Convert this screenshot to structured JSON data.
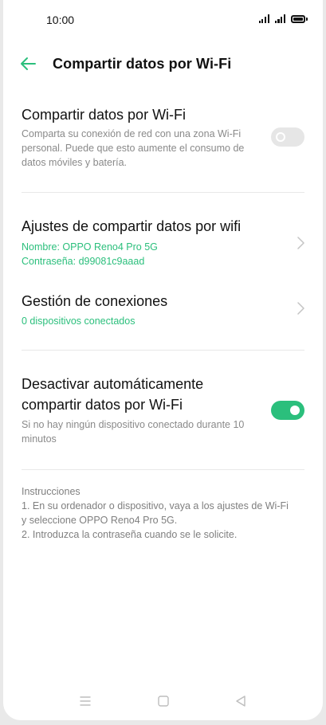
{
  "status_bar": {
    "time": "10:00",
    "icons": [
      "signal-icon",
      "signal-icon",
      "battery-icon"
    ]
  },
  "header": {
    "title": "Compartir datos por Wi-Fi",
    "back_icon": "back-arrow-icon"
  },
  "hotspot": {
    "title": "Compartir datos por Wi-Fi",
    "description": "Comparta su conexión de red con una zona Wi-Fi personal. Puede que esto aumente el consumo de datos móviles y batería.",
    "enabled": false
  },
  "settings": {
    "title": "Ajustes de compartir datos por wifi",
    "name": "Nombre: OPPO Reno4 Pro 5G",
    "password": "Contraseña: d99081c9aaad"
  },
  "connections": {
    "title": "Gestión de conexiones",
    "count": "0 dispositivos conectados"
  },
  "auto_disable": {
    "title_line1": "Desactivar automáticamente",
    "title_line2": "compartir datos por Wi-Fi",
    "description": "Si no hay ningún dispositivo conectado durante 10 minutos",
    "enabled": true
  },
  "instructions": {
    "heading": "Instrucciones",
    "step1": "1. En su ordenador o dispositivo, vaya a los ajustes de Wi-Fi y seleccione OPPO Reno4 Pro 5G.",
    "step2": "2. Introduzca la contraseña cuando se le solicite."
  },
  "navbar": {
    "icons": [
      "menu-icon",
      "home-icon",
      "back-triangle-icon"
    ]
  },
  "colors": {
    "accent": "#2bbf7c",
    "toggle_off": "#e6e6e6",
    "secondary_text": "#8a8a8a"
  }
}
